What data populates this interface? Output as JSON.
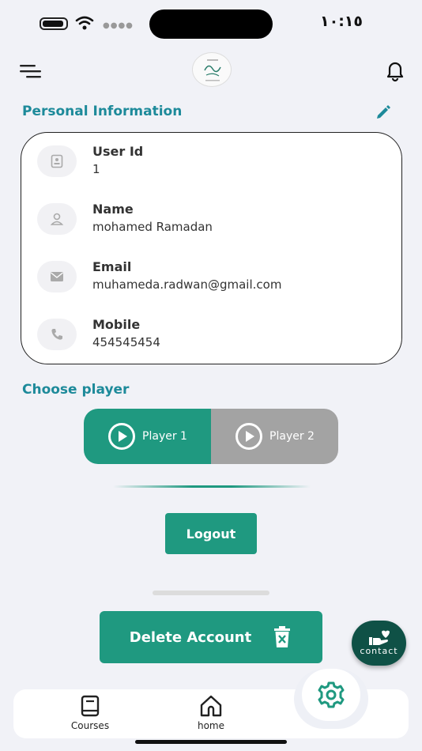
{
  "status_bar": {
    "time": "١٠:١٥"
  },
  "header": {
    "menu_icon": "menu-icon",
    "logo": "app-logo",
    "bell_icon": "bell-icon"
  },
  "personal_info": {
    "title": "Personal Information",
    "edit_icon": "pencil-icon",
    "fields": [
      {
        "icon": "id-card-icon",
        "label": "User Id",
        "value": "1"
      },
      {
        "icon": "user-icon",
        "label": "Name",
        "value": "mohamed Ramadan"
      },
      {
        "icon": "mail-icon",
        "label": "Email",
        "value": "muhameda.radwan@gmail.com"
      },
      {
        "icon": "phone-icon",
        "label": "Mobile",
        "value": "454545454"
      }
    ]
  },
  "player": {
    "title": "Choose player",
    "options": [
      {
        "label": "Player 1",
        "selected": true
      },
      {
        "label": "Player 2",
        "selected": false
      }
    ]
  },
  "actions": {
    "logout": "Logout",
    "delete": "Delete Account",
    "contact": "contact"
  },
  "bottom_nav": {
    "items": [
      {
        "label": "Courses"
      },
      {
        "label": "home"
      }
    ],
    "active_icon": "gear-icon"
  },
  "colors": {
    "primary": "#1f9980",
    "title": "#1d8a9a",
    "inactive": "#a3a3a3",
    "contact": "#0f5146"
  }
}
